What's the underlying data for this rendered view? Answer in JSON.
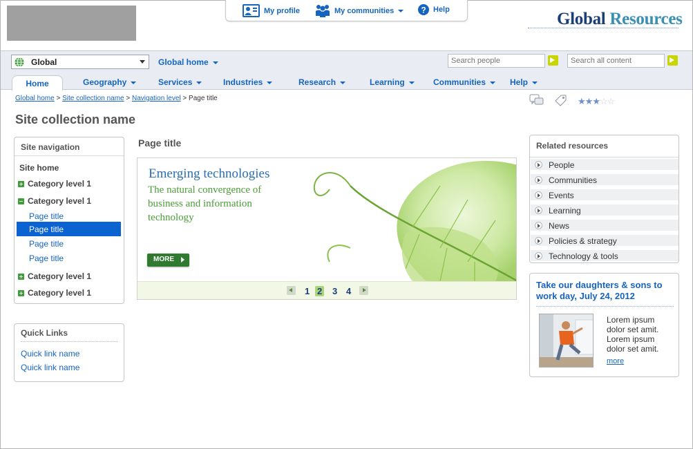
{
  "top_links": {
    "profile": "My profile",
    "communities": "My communities",
    "help": "Help"
  },
  "brand": {
    "part1": "Global",
    "part2": "Resources"
  },
  "scope": {
    "selected": "Global"
  },
  "global_home": "Global home",
  "search": {
    "people_placeholder": "Search people",
    "content_placeholder": "Search all content"
  },
  "tabs": [
    "Home",
    "Geography",
    "Services",
    "Industries",
    "Research",
    "Learning",
    "Communities",
    "Help"
  ],
  "breadcrumb": {
    "items": [
      "Global home",
      "Site collection name",
      "Navigation level"
    ],
    "current": "Page title"
  },
  "rating": {
    "value": 3,
    "max": 5
  },
  "site_title": "Site collection name",
  "site_nav": {
    "heading": "Site navigation",
    "home": "Site home",
    "cat1": "Category level 1",
    "cat2": "Category level 1",
    "pages": [
      "Page title",
      "Page title",
      "Page title",
      "Page title"
    ],
    "cat3": "Category level 1",
    "cat4": "Category level 1"
  },
  "quick_links": {
    "heading": "Quick Links",
    "items": [
      "Quick link name",
      "Quick link name"
    ]
  },
  "page_title": "Page title",
  "hero": {
    "title": "Emerging technologies",
    "subtitle": "The natural convergence of business and information technology",
    "button": "MORE",
    "pages": [
      "1",
      "2",
      "3",
      "4"
    ],
    "current_page": 2
  },
  "related": {
    "heading": "Related resources",
    "items": [
      "People",
      "Communities",
      "Events",
      "Learning",
      "News",
      "Policies & strategy",
      "Technology & tools"
    ]
  },
  "promo": {
    "title": "Take our daughters & sons to work day, July 24, 2012",
    "text": "Lorem ipsum dolor set amit. Lorem ipsum dolor set amit.",
    "more": "more"
  }
}
